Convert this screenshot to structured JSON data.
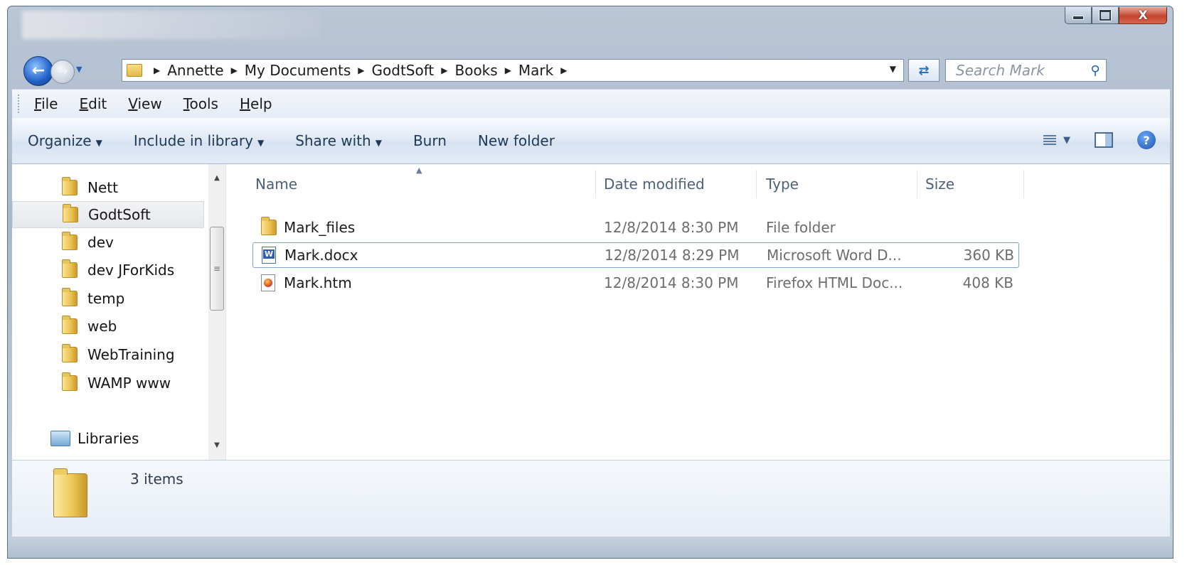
{
  "window": {
    "controls": {
      "minimize": "minimize-icon",
      "maximize": "maximize-icon",
      "close": "close-icon",
      "close_glyph": "X"
    }
  },
  "nav": {
    "back_icon": "back-arrow-icon",
    "forward_icon": "forward-arrow-icon",
    "recent_icon": "recent-pages-chevron-icon"
  },
  "address": {
    "breadcrumbs": [
      "Annette",
      "My Documents",
      "GodtSoft",
      "Books",
      "Mark"
    ],
    "dropdown_icon": "chevron-down-icon",
    "refresh_icon": "refresh-icon"
  },
  "search": {
    "placeholder": "Search Mark",
    "icon": "search-icon"
  },
  "menu": {
    "items": [
      {
        "label": "File",
        "accel": "F",
        "rest": "ile"
      },
      {
        "label": "Edit",
        "accel": "E",
        "rest": "dit"
      },
      {
        "label": "View",
        "accel": "V",
        "rest": "iew"
      },
      {
        "label": "Tools",
        "accel": "T",
        "rest": "ools"
      },
      {
        "label": "Help",
        "accel": "H",
        "rest": "elp"
      }
    ]
  },
  "toolbar": {
    "organize": "Organize",
    "include": "Include in library",
    "share": "Share with",
    "burn": "Burn",
    "new_folder": "New folder",
    "view_icon": "change-view-icon",
    "preview_icon": "preview-pane-icon",
    "help_icon": "help-icon",
    "help_glyph": "?"
  },
  "sidebar": {
    "items": [
      {
        "label": "Nett",
        "selected": false
      },
      {
        "label": "GodtSoft",
        "selected": true
      },
      {
        "label": "dev",
        "selected": false
      },
      {
        "label": "dev JForKids",
        "selected": false
      },
      {
        "label": "temp",
        "selected": false
      },
      {
        "label": "web",
        "selected": false
      },
      {
        "label": "WebTraining",
        "selected": false
      },
      {
        "label": "WAMP www",
        "selected": false
      }
    ],
    "libraries": "Libraries"
  },
  "columns": {
    "name": "Name",
    "date": "Date modified",
    "type": "Type",
    "size": "Size"
  },
  "files": [
    {
      "name": "Mark_files",
      "date": "12/8/2014 8:30 PM",
      "type": "File folder",
      "size": "",
      "icon": "folder-icon",
      "selected": false
    },
    {
      "name": "Mark.docx",
      "date": "12/8/2014 8:29 PM",
      "type": "Microsoft Word D...",
      "size": "360 KB",
      "icon": "word-document-icon",
      "selected": true
    },
    {
      "name": "Mark.htm",
      "date": "12/8/2014 8:30 PM",
      "type": "Firefox HTML Doc...",
      "size": "408 KB",
      "icon": "firefox-html-icon",
      "selected": false
    }
  ],
  "status": {
    "count": "3 items"
  }
}
